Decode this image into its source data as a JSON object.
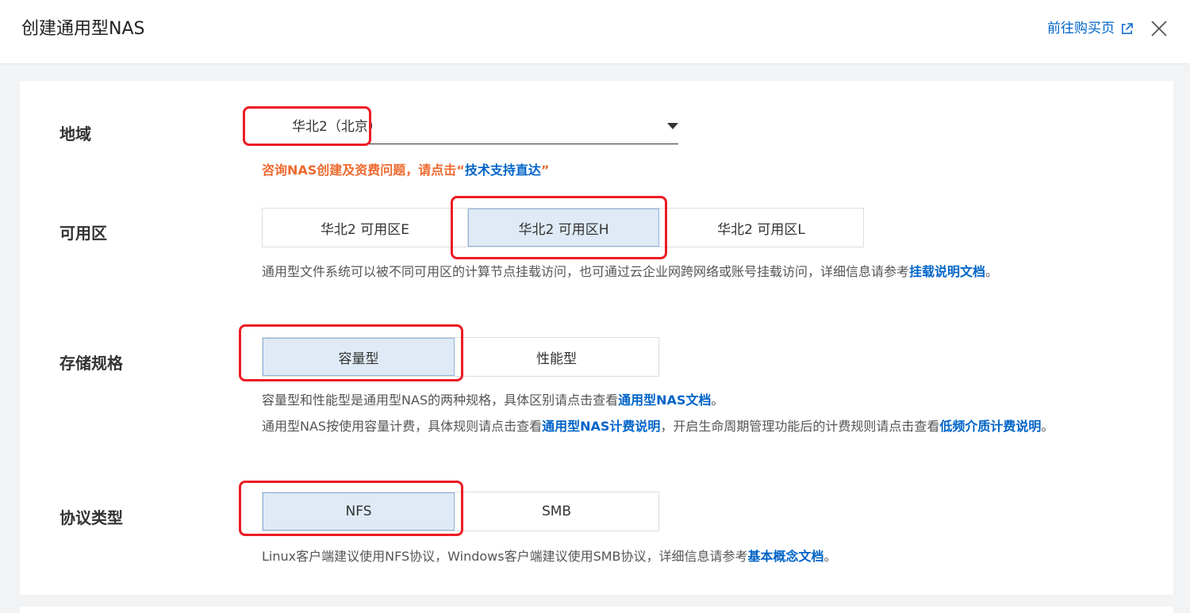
{
  "header": {
    "title": "创建通用型NAS",
    "buy_link": "前往购买页"
  },
  "region": {
    "label": "地域",
    "value": "华北2（北京）",
    "hint_prefix": "咨询NAS创建及资费问题，请点击“",
    "hint_link": "技术支持直达",
    "hint_suffix": "”"
  },
  "zone": {
    "label": "可用区",
    "options": [
      "华北2 可用区E",
      "华北2 可用区H",
      "华北2 可用区L"
    ],
    "selected": "华北2 可用区H",
    "desc_text": "通用型文件系统可以被不同可用区的计算节点挂载访问，也可通过云企业网跨网络或账号挂载访问，详细信息请参考",
    "desc_link": "挂载说明文档",
    "desc_end": "。"
  },
  "storage": {
    "label": "存储规格",
    "options": [
      "容量型",
      "性能型"
    ],
    "selected": "容量型",
    "desc1_text": "容量型和性能型是通用型NAS的两种规格，具体区别请点击查看",
    "desc1_link": "通用型NAS文档",
    "desc1_end": "。",
    "desc2_text": "通用型NAS按使用容量计费，具体规则请点击查看",
    "desc2_link1": "通用型NAS计费说明",
    "desc2_mid": "，开启生命周期管理功能后的计费规则请点击查看",
    "desc2_link2": "低频介质计费说明",
    "desc2_end": "。"
  },
  "protocol": {
    "label": "协议类型",
    "options": [
      "NFS",
      "SMB"
    ],
    "selected": "NFS",
    "desc_text": "Linux客户端建议使用NFS协议，Windows客户端建议使用SMB协议，详细信息请参考",
    "desc_link": "基本概念文档",
    "desc_end": "。"
  },
  "colors": {
    "link": "#0064c8",
    "warning": "#ee6a2f",
    "highlight": "#ec1c24",
    "selected_bg": "#dfeaf6"
  },
  "icons": [
    "external-link-icon",
    "close-icon",
    "caret-down-icon"
  ]
}
